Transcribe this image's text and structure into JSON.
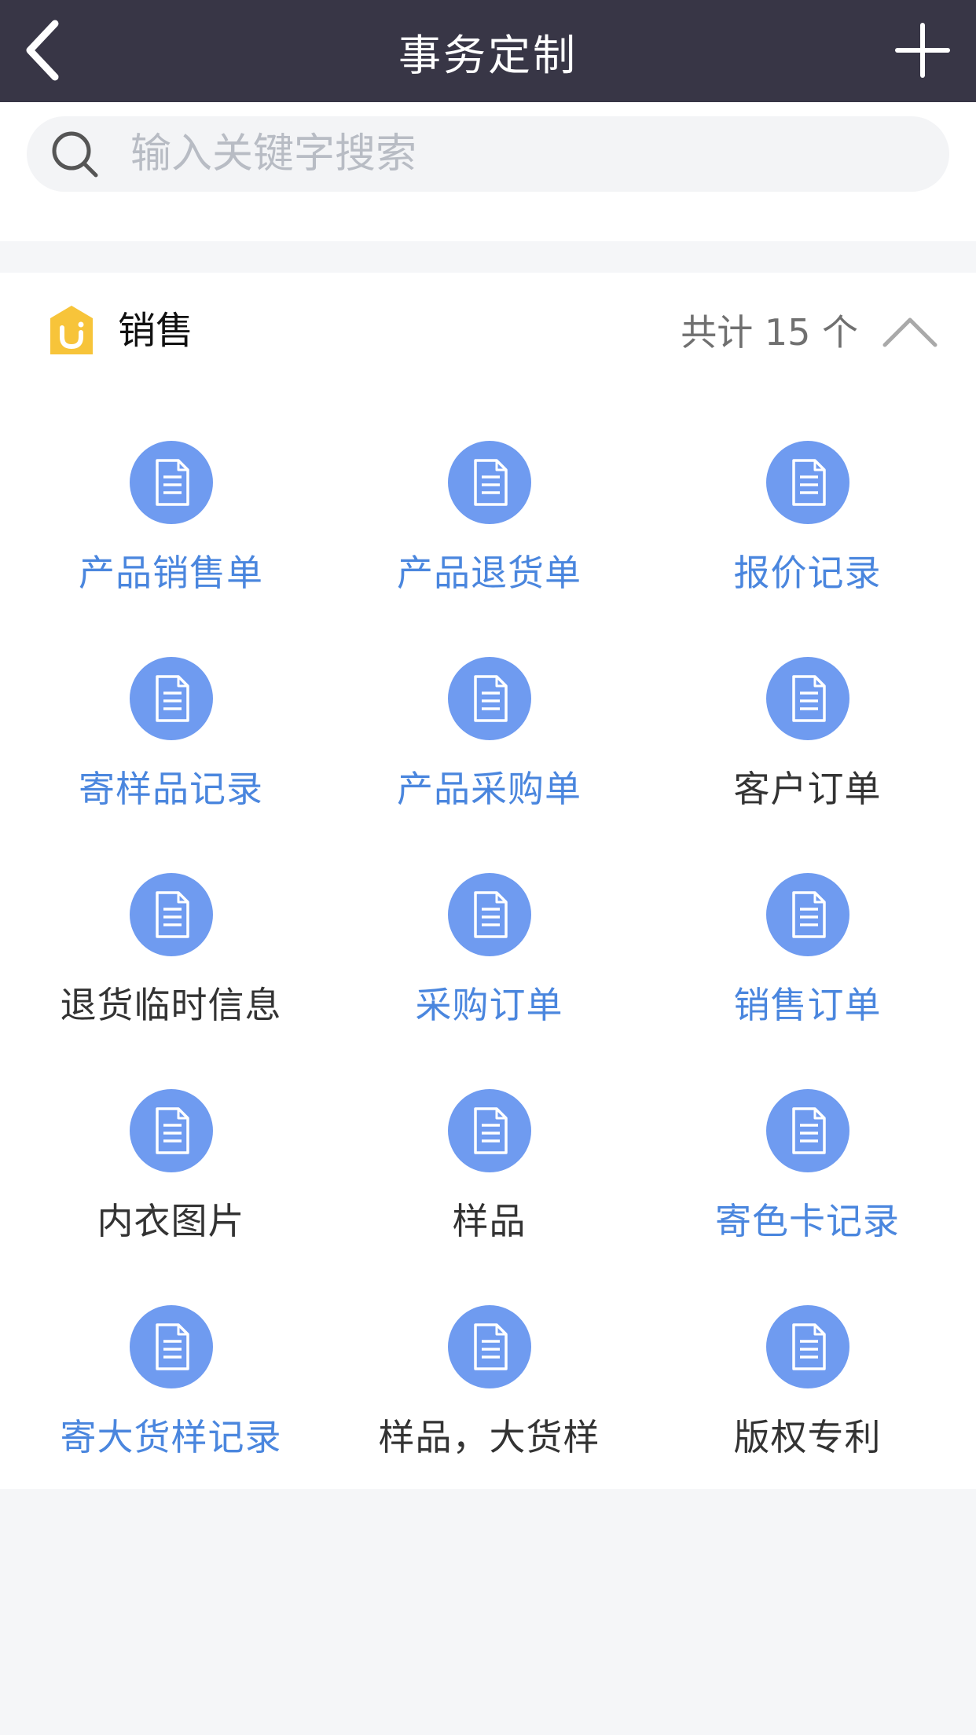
{
  "header": {
    "title": "事务定制",
    "back_icon": "chevron-left-icon",
    "add_icon": "plus-icon"
  },
  "search": {
    "placeholder": "输入关键字搜索",
    "value": ""
  },
  "section": {
    "title": "销售",
    "count_text": "共计 15 个",
    "icon": "sales-logo-icon",
    "collapse_icon": "chevron-up-icon",
    "items": [
      {
        "label": "产品销售单",
        "style": "blue"
      },
      {
        "label": "产品退货单",
        "style": "blue"
      },
      {
        "label": "报价记录",
        "style": "blue"
      },
      {
        "label": "寄样品记录",
        "style": "blue"
      },
      {
        "label": "产品采购单",
        "style": "blue"
      },
      {
        "label": "客户订单",
        "style": "gray"
      },
      {
        "label": "退货临时信息",
        "style": "gray"
      },
      {
        "label": "采购订单",
        "style": "blue"
      },
      {
        "label": "销售订单",
        "style": "blue"
      },
      {
        "label": "内衣图片",
        "style": "gray"
      },
      {
        "label": "样品",
        "style": "gray"
      },
      {
        "label": "寄色卡记录",
        "style": "blue"
      },
      {
        "label": "寄大货样记录",
        "style": "blue"
      },
      {
        "label": "样品，大货样",
        "style": "gray"
      },
      {
        "label": "版权专利",
        "style": "gray"
      }
    ]
  },
  "colors": {
    "navbar": "#383646",
    "accent_blue": "#4a86de",
    "icon_circle": "#6f9bf0",
    "section_icon": "#f7c43a"
  }
}
